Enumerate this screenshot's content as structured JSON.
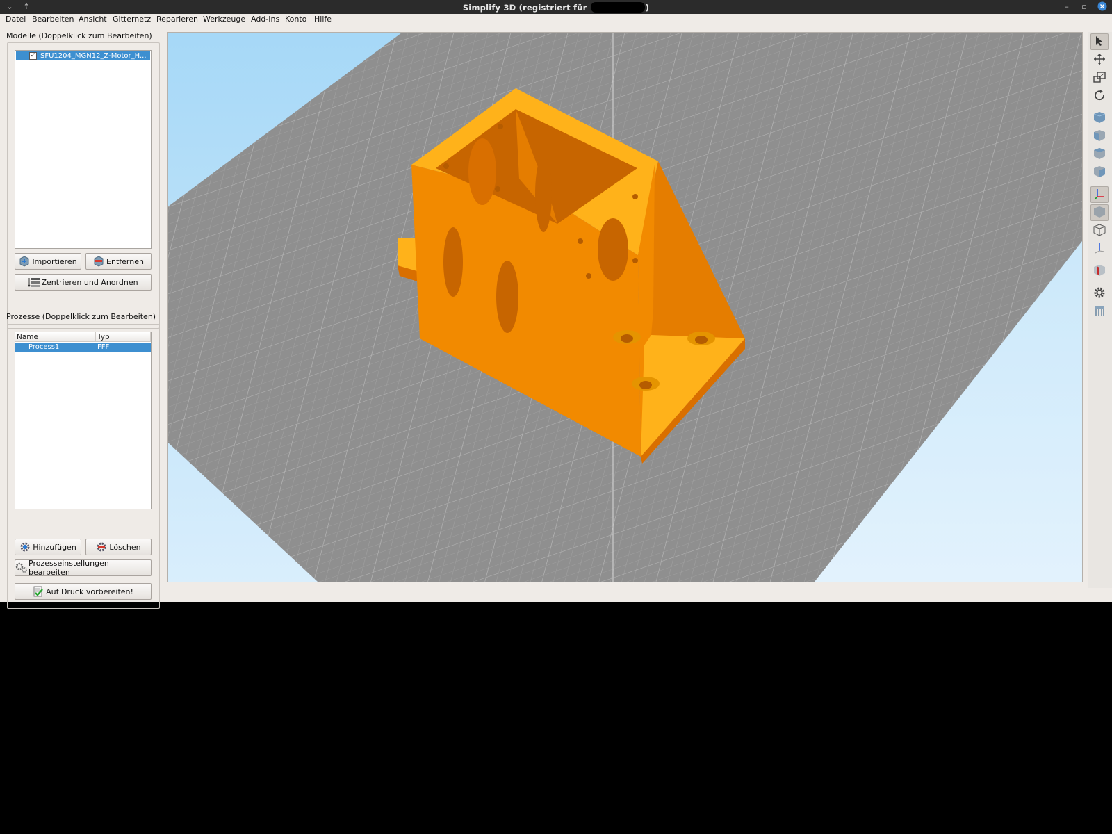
{
  "window": {
    "title_prefix": "Simplify 3D (registriert für ",
    "title_suffix": ")"
  },
  "menu": [
    "Datei",
    "Bearbeiten",
    "Ansicht",
    "Gitternetz",
    "Reparieren",
    "Werkzeuge",
    "Add-Ins",
    "Konto",
    "Hilfe"
  ],
  "models": {
    "title": "Modelle (Doppelklick zum Bearbeiten)",
    "items": [
      {
        "label": "SFU1204_MGN12_Z-Motor_H...",
        "checked": true
      }
    ],
    "buttons": {
      "import": "Importieren",
      "remove": "Entfernen",
      "center": "Zentrieren und Anordnen"
    }
  },
  "processes": {
    "title": "Prozesse (Doppelklick zum Bearbeiten)",
    "columns": [
      "Name",
      "Typ"
    ],
    "rows": [
      {
        "name": "Process1",
        "type": "FFF"
      }
    ],
    "buttons": {
      "add": "Hinzufügen",
      "delete": "Löschen",
      "settings": "Prozesseinstellungen bearbeiten",
      "prepare": "Auf Druck vorbereiten!"
    }
  },
  "colors": {
    "model": "#f28a00",
    "model_light": "#ffb21a",
    "model_dark": "#d96f00",
    "bed": "#8f8f8f",
    "sky": "#a6d8f7",
    "selection": "#3d8fd0"
  },
  "right_toolbar": [
    "select-icon",
    "move-icon",
    "scale-icon",
    "rotate-icon",
    "view-iso-icon",
    "view-front-icon",
    "view-top-icon",
    "view-side-icon",
    "axes-icon",
    "solid-view-icon",
    "wireframe-view-icon",
    "z-axis-icon",
    "cross-section-icon",
    "settings-gear-icon",
    "supports-icon"
  ]
}
